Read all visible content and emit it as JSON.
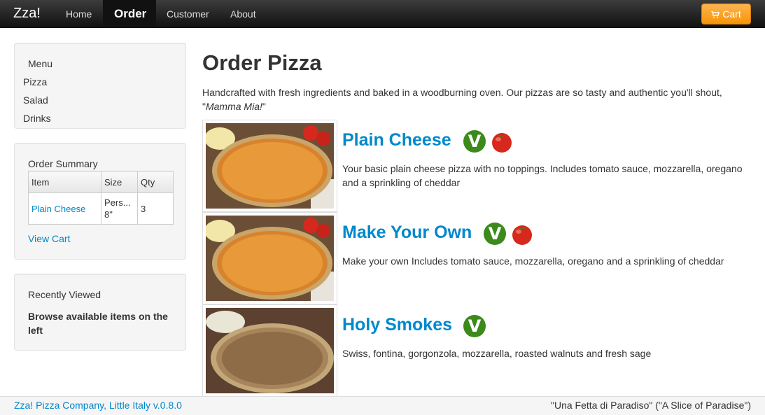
{
  "navbar": {
    "brand": "Zza!",
    "items": [
      {
        "label": "Home"
      },
      {
        "label": "Order",
        "active": true
      },
      {
        "label": "Customer"
      },
      {
        "label": "About"
      }
    ],
    "cart_label": "Cart",
    "cart_icon": "shopping-cart-icon",
    "cart_color": "#f89406"
  },
  "sidebar": {
    "menu": {
      "title": "Menu",
      "items": [
        "Pizza",
        "Salad",
        "Drinks"
      ]
    },
    "order_summary": {
      "title": "Order Summary",
      "columns": [
        "Item",
        "Size",
        "Qty"
      ],
      "rows": [
        {
          "item": "Plain Cheese",
          "size": "Pers... 8\"",
          "qty": "3"
        }
      ],
      "view_cart": "View Cart"
    },
    "recently_viewed": {
      "title": "Recently Viewed",
      "empty_text": "Browse available items on the left"
    }
  },
  "main": {
    "title": "Order Pizza",
    "intro_text": "Handcrafted with fresh ingredients and baked in a woodburning oven. Our pizzas are so tasty and authentic you'll shout, \"",
    "intro_em": "Mamma Mia!",
    "intro_end": "\"",
    "products": [
      {
        "name": "Plain Cheese",
        "description": "Your basic plain cheese pizza with no toppings. Includes tomato sauce, mozzarella, oregano and a sprinkling of cheddar",
        "badges": [
          "vegetarian-icon",
          "tomato-icon"
        ]
      },
      {
        "name": "Make Your Own",
        "description": "Make your own Includes tomato sauce, mozzarella, oregano and a sprinkling of cheddar",
        "badges": [
          "vegetarian-icon",
          "tomato-icon"
        ]
      },
      {
        "name": "Holy Smokes",
        "description": "Swiss, fontina, gorgonzola, mozzarella, roasted walnuts and fresh sage",
        "badges": [
          "vegetarian-icon"
        ]
      }
    ]
  },
  "footer": {
    "left": "Zza! Pizza Company, Little Italy v.0.8.0",
    "right": "\"Una Fetta di Paradiso\" (\"A Slice of Paradise\")"
  }
}
